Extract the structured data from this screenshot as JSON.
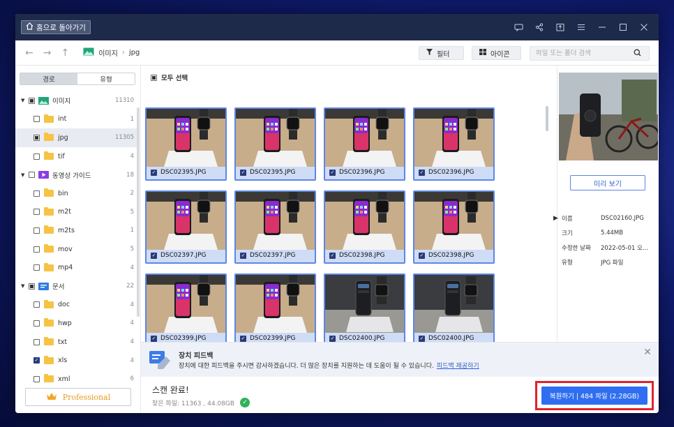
{
  "titlebar": {
    "home_label": "홈으로 돌아가기"
  },
  "toolbar": {
    "breadcrumb": [
      "이미지",
      "jpg"
    ],
    "filter_label": "필터",
    "icon_view_label": "아이콘",
    "search_placeholder": "파일 또는 폴더 검색"
  },
  "sidebar": {
    "tabs": [
      "경로",
      "유형"
    ],
    "active_tab": 1,
    "tree": [
      {
        "label": "이미지",
        "count": "11310",
        "level": 0,
        "state": "part",
        "icon": "image-icon"
      },
      {
        "label": "int",
        "count": "1",
        "level": 1,
        "state": "none"
      },
      {
        "label": "jpg",
        "count": "11305",
        "level": 1,
        "state": "part",
        "selected": true
      },
      {
        "label": "tif",
        "count": "4",
        "level": 1,
        "state": "none"
      },
      {
        "label": "동영상 가이드",
        "count": "18",
        "level": 0,
        "state": "none",
        "icon": "video-icon"
      },
      {
        "label": "bin",
        "count": "2",
        "level": 1,
        "state": "none"
      },
      {
        "label": "m2t",
        "count": "5",
        "level": 1,
        "state": "none"
      },
      {
        "label": "m2ts",
        "count": "1",
        "level": 1,
        "state": "none"
      },
      {
        "label": "mov",
        "count": "5",
        "level": 1,
        "state": "none"
      },
      {
        "label": "mp4",
        "count": "4",
        "level": 1,
        "state": "none"
      },
      {
        "label": "문서",
        "count": "22",
        "level": 0,
        "state": "part",
        "icon": "document-icon"
      },
      {
        "label": "doc",
        "count": "4",
        "level": 1,
        "state": "none"
      },
      {
        "label": "hwp",
        "count": "4",
        "level": 1,
        "state": "none"
      },
      {
        "label": "txt",
        "count": "4",
        "level": 1,
        "state": "none"
      },
      {
        "label": "xls",
        "count": "4",
        "level": 1,
        "state": "checked"
      },
      {
        "label": "xml",
        "count": "6",
        "level": 1,
        "state": "none"
      }
    ],
    "pro_label": "Professional"
  },
  "grid": {
    "select_all_label": "모두 선택",
    "files": [
      {
        "name": "DSC02395.JPG",
        "scene": "phone"
      },
      {
        "name": "DSC02395.JPG",
        "scene": "phone"
      },
      {
        "name": "DSC02396.JPG",
        "scene": "phone"
      },
      {
        "name": "DSC02396.JPG",
        "scene": "phone"
      },
      {
        "name": "DSC02397.JPG",
        "scene": "phone"
      },
      {
        "name": "DSC02397.JPG",
        "scene": "phone"
      },
      {
        "name": "DSC02398.JPG",
        "scene": "phone"
      },
      {
        "name": "DSC02398.JPG",
        "scene": "phone"
      },
      {
        "name": "DSC02399.JPG",
        "scene": "phone"
      },
      {
        "name": "DSC02399.JPG",
        "scene": "phone"
      },
      {
        "name": "DSC02400.JPG",
        "scene": "dark"
      },
      {
        "name": "DSC02400.JPG",
        "scene": "dark"
      }
    ]
  },
  "preview": {
    "button_label": "미리 보기",
    "props": [
      {
        "key": "이름",
        "value": "DSC02160.JPG"
      },
      {
        "key": "크기",
        "value": "5.44MB"
      },
      {
        "key": "수정한 날짜",
        "value": "2022-05-01 오..."
      },
      {
        "key": "유형",
        "value": "JPG 파일"
      }
    ]
  },
  "feedback": {
    "title": "장치 피드백",
    "text": "장치에 대한 피드백을 주시면 감사하겠습니다. 더 많은 장치를 지원하는 데 도움이 될 수 있습니다.",
    "link": "피드백 제공하기"
  },
  "status": {
    "title": "스캔 완료!",
    "subtitle": "찾은 파일: 11363 , 44.08GB",
    "recover_label": "복원하기 | 484 파일 (2.28GB)"
  },
  "colors": {
    "accent": "#2f6ef0",
    "titlebar": "#1e2a4a",
    "highlight": "#e4212b"
  }
}
